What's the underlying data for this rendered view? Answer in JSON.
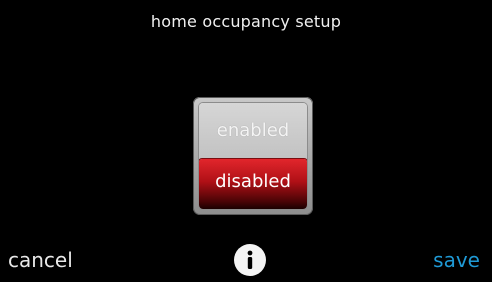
{
  "header": {
    "title": "home occupancy setup"
  },
  "selector": {
    "options": [
      {
        "label": "enabled",
        "selected": false
      },
      {
        "label": "disabled",
        "selected": true
      }
    ],
    "selected_value": "disabled"
  },
  "footer": {
    "cancel_label": "cancel",
    "save_label": "save",
    "info_icon": "info-icon"
  },
  "colors": {
    "background": "#000000",
    "selected_option": "#c8181e",
    "save_accent": "#1f9ad6"
  }
}
